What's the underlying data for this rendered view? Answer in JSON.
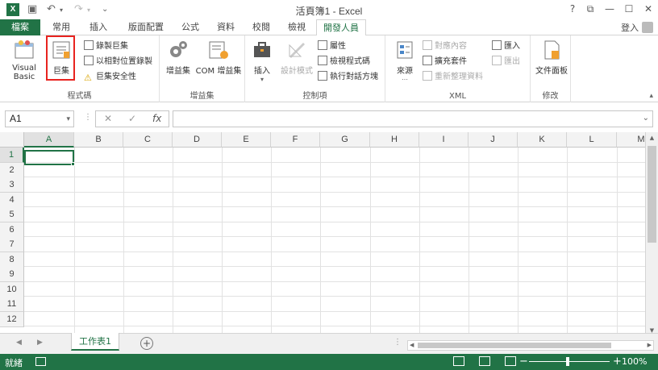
{
  "app": {
    "title": "活頁簿1 - Excel",
    "brand_color": "#217346",
    "app_icon_letter": "X"
  },
  "window_controls": [
    "?",
    "⧉",
    "—",
    "☐",
    "✕"
  ],
  "ribbon_tabs": {
    "file": "檔案",
    "items": [
      "常用",
      "插入",
      "版面配置",
      "公式",
      "資料",
      "校閱",
      "檢視",
      "開發人員"
    ],
    "active": "開發人員",
    "signin": "登入"
  },
  "ribbon": {
    "code_group": {
      "label": "程式碼",
      "visual_basic": "Visual Basic",
      "macros": "巨集",
      "record_macro": "錄製巨集",
      "relative_ref": "以相對位置錄製",
      "macro_security": "巨集安全性"
    },
    "addins_group": {
      "label": "增益集",
      "addins": "增益集",
      "com_addins": "COM 增益集"
    },
    "controls_group": {
      "label": "控制項",
      "insert": "插入",
      "design_mode": "設計模式",
      "properties": "屬性",
      "view_code": "檢視程式碼",
      "run_dialog": "執行對話方塊"
    },
    "xml_group": {
      "label": "XML",
      "source": "來源",
      "map_properties": "對應內容",
      "expansion_packs": "擴充套件",
      "refresh_data": "重新整理資料",
      "import": "匯入",
      "export": "匯出"
    },
    "modify_group": {
      "label": "修改",
      "document_panel": "文件面板"
    }
  },
  "formula_bar": {
    "name_box": "A1",
    "cancel": "✕",
    "enter": "✓",
    "fx": "fx",
    "formula": ""
  },
  "grid": {
    "columns": [
      "A",
      "B",
      "C",
      "D",
      "E",
      "F",
      "G",
      "H",
      "I",
      "J",
      "K",
      "L",
      "M"
    ],
    "rows": [
      "1",
      "2",
      "3",
      "4",
      "5",
      "6",
      "7",
      "8",
      "9",
      "10",
      "11",
      "12"
    ],
    "active_cell": "A1"
  },
  "sheets": {
    "tabs": [
      "工作表1"
    ],
    "active": "工作表1",
    "add": "+"
  },
  "status_bar": {
    "ready": "就緒",
    "zoom_out": "−",
    "zoom_in": "+",
    "zoom": "100%"
  }
}
